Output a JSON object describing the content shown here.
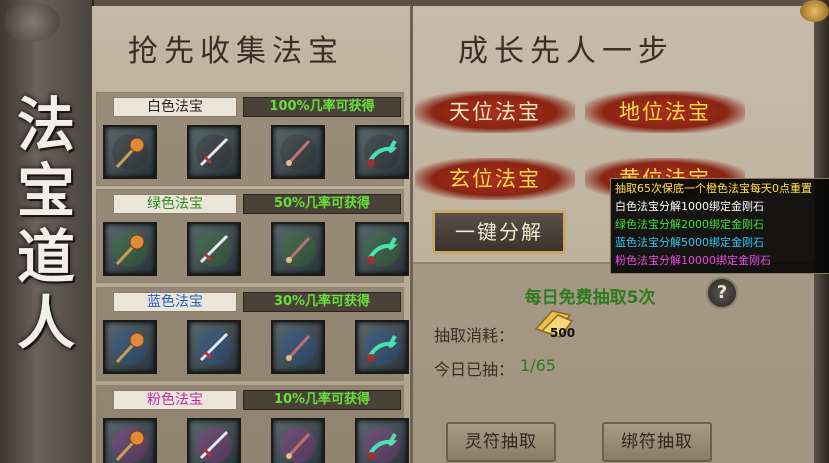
{
  "banner": {
    "title_chars": [
      "法",
      "宝",
      "道",
      "人"
    ]
  },
  "left_header": {
    "title": "抢先收集法宝"
  },
  "right_header": {
    "title": "成长先人一步"
  },
  "grades": [
    {
      "name": "白色法宝",
      "rate": "100%几率可获得",
      "color": "#2a2420"
    },
    {
      "name": "绿色法宝",
      "rate": "50%几率可获得",
      "color": "#2f8a1e"
    },
    {
      "name": "蓝色法宝",
      "rate": "30%几率可获得",
      "color": "#2060c0"
    },
    {
      "name": "粉色法宝",
      "rate": "10%几率可获得",
      "color": "#c02aa8"
    }
  ],
  "item_icons": [
    "orb-staff-icon",
    "flying-sword-icon",
    "dagger-icon",
    "jade-whip-icon"
  ],
  "tiers": {
    "heaven": "天位法宝",
    "earth": "地位法宝",
    "mystic": "玄位法宝",
    "yellow": "黄位法宝"
  },
  "decompose_button": "一键分解",
  "daily_free": "每日免费抽取5次",
  "help_icon": "?",
  "cost_label": "抽取消耗：",
  "cost_amount": "500",
  "today_label": "今日已抽：",
  "today_value": "1/65",
  "buttons": {
    "spirit_draw": "灵符抽取",
    "bind_draw": "绑符抽取"
  },
  "tooltip": [
    {
      "text": "抽取65次保底一个橙色法宝每天0点重置",
      "color": "#ffe24a"
    },
    {
      "text": "白色法宝分解1000绑定金刚石",
      "color": "#ffffff"
    },
    {
      "text": "绿色法宝分解2000绑定金刚石",
      "color": "#3ee03a"
    },
    {
      "text": "蓝色法宝分解5000绑定金刚石",
      "color": "#33c8f0"
    },
    {
      "text": "粉色法宝分解10000绑定金刚石",
      "color": "#f04ae6"
    }
  ]
}
